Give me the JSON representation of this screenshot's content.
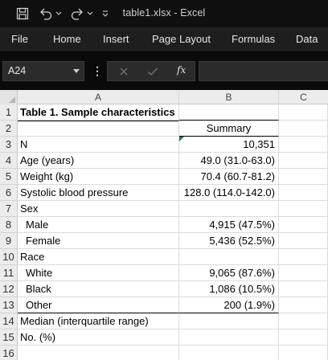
{
  "window": {
    "title": "table1.xlsx  -  Excel",
    "quick_access": [
      "save-icon",
      "undo-icon",
      "redo-icon",
      "customize-icon"
    ]
  },
  "ribbon": {
    "tabs": [
      "File",
      "Home",
      "Insert",
      "Page Layout",
      "Formulas",
      "Data"
    ]
  },
  "formula_bar": {
    "name_box": "A24",
    "fx": "fx",
    "formula": ""
  },
  "grid": {
    "columns": [
      "A",
      "B",
      "C"
    ],
    "rows": [
      {
        "num": "1",
        "a": "Table 1. Sample characteristics",
        "b": ""
      },
      {
        "num": "2",
        "a": "",
        "b": "Summary"
      },
      {
        "num": "3",
        "a": "N",
        "b": "10,351"
      },
      {
        "num": "4",
        "a": "Age (years)",
        "b": "49.0 (31.0-63.0)"
      },
      {
        "num": "5",
        "a": "Weight (kg)",
        "b": "70.4 (60.7-81.2)"
      },
      {
        "num": "6",
        "a": "Systolic blood pressure",
        "b": "128.0 (114.0-142.0)"
      },
      {
        "num": "7",
        "a": "Sex",
        "b": ""
      },
      {
        "num": "8",
        "a": "Male",
        "b": "4,915 (47.5%)"
      },
      {
        "num": "9",
        "a": "Female",
        "b": "5,436 (52.5%)"
      },
      {
        "num": "10",
        "a": "Race",
        "b": ""
      },
      {
        "num": "11",
        "a": "White",
        "b": "9,065 (87.6%)"
      },
      {
        "num": "12",
        "a": "Black",
        "b": "1,086 (10.5%)"
      },
      {
        "num": "13",
        "a": "Other",
        "b": "200 (1.9%)"
      },
      {
        "num": "14",
        "a": "Median (interquartile range)",
        "b": ""
      },
      {
        "num": "15",
        "a": "No. (%)",
        "b": ""
      },
      {
        "num": "16",
        "a": "",
        "b": ""
      }
    ]
  }
}
